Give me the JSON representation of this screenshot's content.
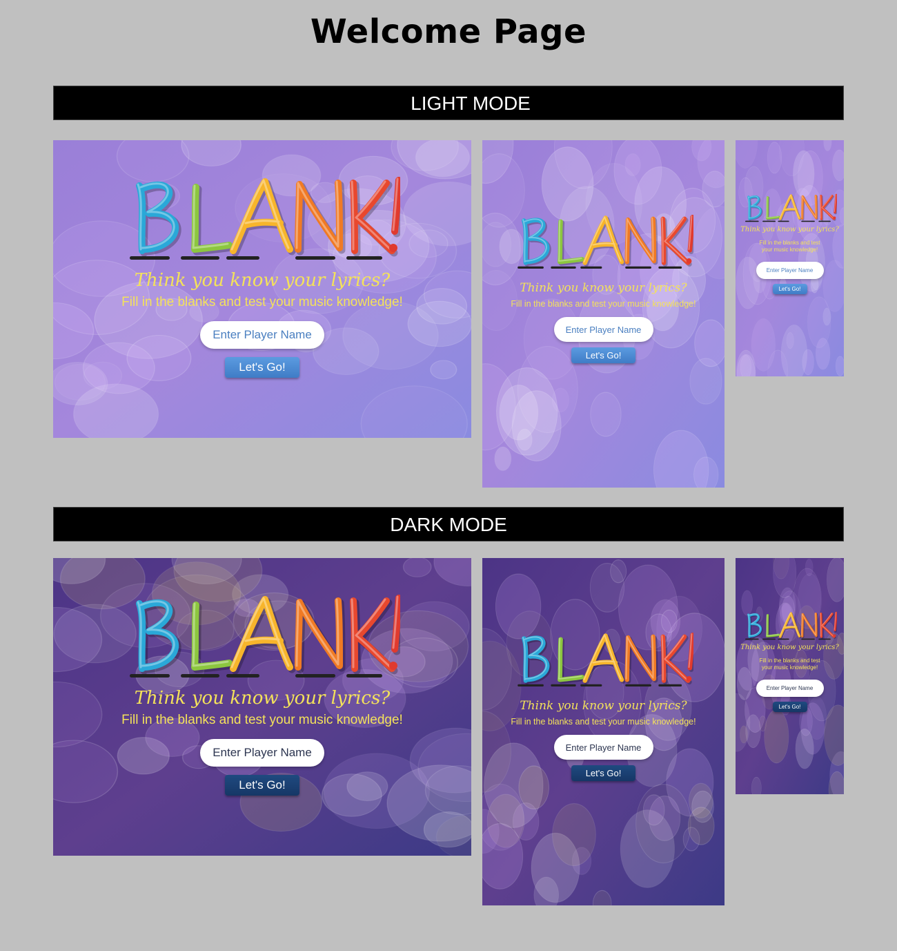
{
  "page_title": "Welcome Page",
  "sections": {
    "light_label": "LIGHT MODE",
    "dark_label": "DARK MODE"
  },
  "welcome": {
    "logo_text": "BLANK!",
    "tagline": "Think you know your lyrics?",
    "subtitle": "Fill in the blanks and test your music knowledge!",
    "subtitle_small_line1": "Fill in the blanks and test",
    "subtitle_small_line2": "your music knowledge!",
    "name_placeholder": "Enter Player Name",
    "go_label": "Let's Go!"
  },
  "colors": {
    "page_background": "#c0c0c0",
    "section_bar": "#000000",
    "light_bg": "#9a7fd8",
    "dark_bg": "#5e3f8e",
    "tagline": "#f4e25a",
    "light_button": "#4a88d0",
    "dark_button": "#1b3f73",
    "logo_gradient": [
      "#2aa8d8",
      "#8cc63f",
      "#f7b52b",
      "#f07a24",
      "#e03a2e"
    ]
  }
}
